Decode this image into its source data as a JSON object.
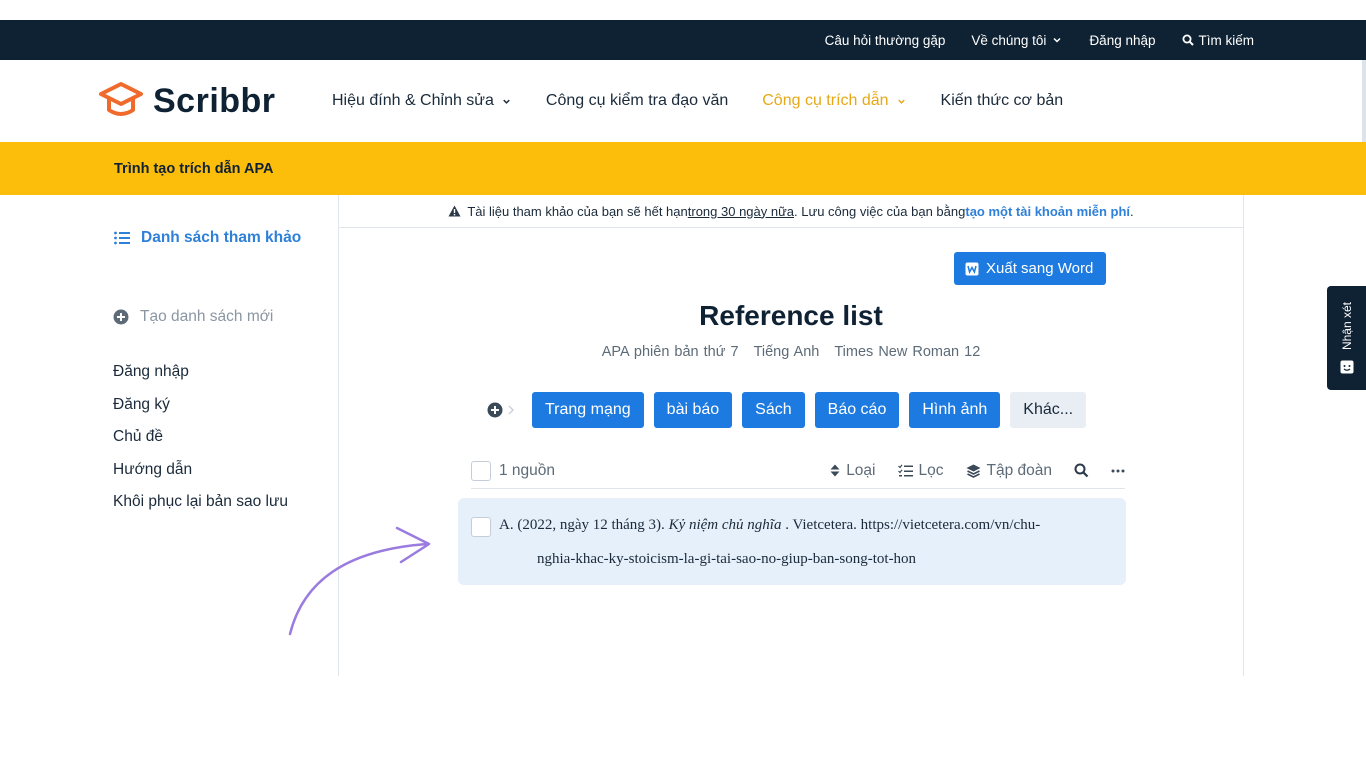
{
  "topbar": {
    "faq": "Câu hỏi thường gặp",
    "about": "Về chúng tôi",
    "login": "Đăng nhập",
    "search": "Tìm kiếm"
  },
  "logo": {
    "text": "Scribbr"
  },
  "nav": {
    "items": [
      {
        "label": "Hiệu đính & Chỉnh sửa",
        "dropdown": true
      },
      {
        "label": "Công cụ kiểm tra đạo văn",
        "dropdown": false
      },
      {
        "label": "Công cụ trích dẫn",
        "dropdown": true,
        "active": true
      },
      {
        "label": "Kiến thức cơ bản",
        "dropdown": false
      }
    ]
  },
  "banner": {
    "title": "Trình tạo trích dẫn APA"
  },
  "sidebar": {
    "reference_list": "Danh sách tham khảo",
    "new_list": "Tạo danh sách mới",
    "links": [
      "Đăng nhập",
      "Đăng ký",
      "Chủ đề",
      "Hướng dẫn",
      "Khôi phục lại bản sao lưu"
    ]
  },
  "warning": {
    "prefix": "Tài liệu tham khảo của bạn sẽ hết hạn",
    "underlined": "trong 30 ngày nữa",
    "middle": ". Lưu công việc của bạn bằng",
    "link": "tạo một tài khoản miễn phí",
    "suffix": "."
  },
  "main": {
    "export_label": "Xuất sang Word",
    "title": "Reference list",
    "meta": [
      "APA phiên bản thứ 7",
      "Tiếng Anh",
      "Times New Roman 12"
    ],
    "source_types": [
      "Trang mạng",
      "bài báo",
      "Sách",
      "Báo cáo",
      "Hình ảnh"
    ],
    "other_label": "Khác...",
    "source_count": "1 nguồn",
    "tools": {
      "sort": "Loại",
      "filter": "Lọc",
      "group": "Tập đoàn"
    },
    "entry": {
      "author": "A. (2022, ngày 12 tháng 3).",
      "title_italic": "Kỷ niệm chủ nghĩa",
      "publisher": ". Vietcetera. https://vietcetera.com/vn/chu-",
      "line2": "nghia-khac-ky-stoicism-la-gi-tai-sao-no-giup-ban-song-tot-hon"
    }
  },
  "feedback": {
    "label": "Nhận xét"
  },
  "colors": {
    "topbar_bg": "#0f2233",
    "banner": "#fcbd0b",
    "accent_blue": "#1d7ae0",
    "brand_orange": "#f06a2c",
    "entry_bg": "#e6f0fb",
    "arrow": "#9a7be0"
  },
  "icons": [
    "search-icon",
    "chevron-down-icon",
    "graduation-cap-icon",
    "list-icon",
    "plus-circle-icon",
    "warning-icon",
    "word-icon",
    "sort-icon",
    "filter-icon",
    "layers-icon",
    "more-icon",
    "feedback-icon",
    "arrow-icon"
  ]
}
